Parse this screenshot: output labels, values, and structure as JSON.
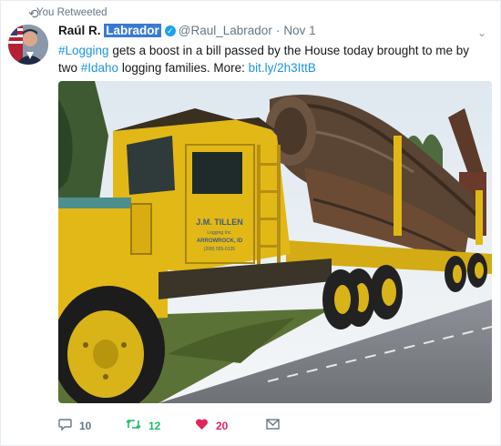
{
  "retweet_label": "You Retweeted",
  "author": {
    "first_name": "Raúl R.",
    "last_name_highlighted": "Labrador",
    "handle": "@Raul_Labrador",
    "separator": "·",
    "date": "Nov 1"
  },
  "tweet": {
    "hashtag1": "#Logging",
    "text1": " gets a boost in a bill passed by the House today brought to me by two ",
    "hashtag2": "#Idaho",
    "text2": " logging families. More: ",
    "link": "bit.ly/2h3IttB"
  },
  "photo_truck_text": {
    "company": "J.M. TILLEN",
    "line2": "Logging Inc.",
    "city": "ARROWROCK, ID",
    "phone": "(208) 555-0135"
  },
  "actions": {
    "replies": "10",
    "retweets": "12",
    "likes": "20"
  },
  "icons": {
    "retweet": "retweet-icon",
    "verified": "verified-badge-icon",
    "caret": "chevron-down-icon",
    "reply": "reply-icon",
    "like": "heart-icon",
    "dm": "envelope-icon"
  },
  "colors": {
    "link": "#1b95e0",
    "retweet_green": "#17bf63",
    "like_red": "#e0245e",
    "muted": "#657786"
  }
}
